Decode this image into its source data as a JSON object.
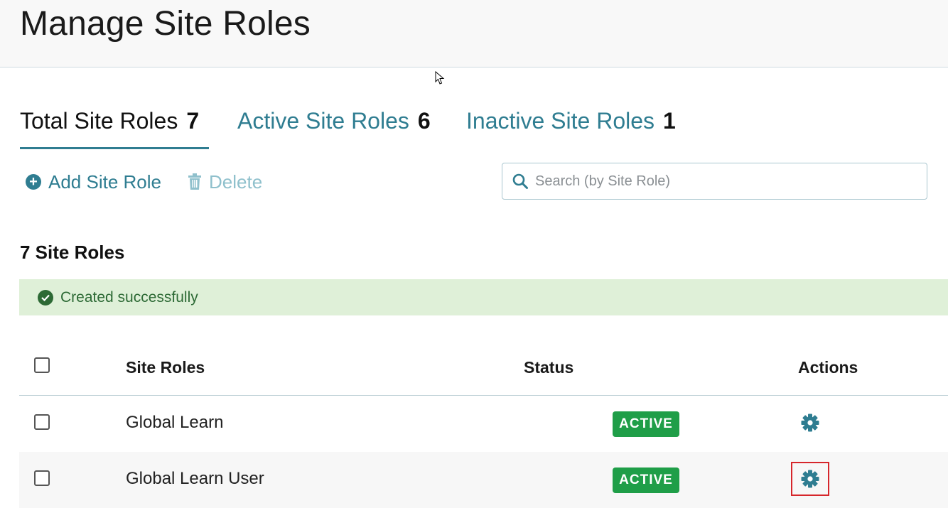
{
  "page": {
    "title": "Manage Site Roles"
  },
  "tabs": [
    {
      "label": "Total Site Roles",
      "count": "7"
    },
    {
      "label": "Active Site Roles",
      "count": "6"
    },
    {
      "label": "Inactive Site Roles",
      "count": "1"
    }
  ],
  "toolbar": {
    "add_label": "Add Site Role",
    "delete_label": "Delete"
  },
  "search": {
    "placeholder": "Search (by Site Role)",
    "value": ""
  },
  "list": {
    "count_heading": "7 Site Roles"
  },
  "alert": {
    "message": "Created successfully"
  },
  "table": {
    "headers": {
      "name": "Site Roles",
      "status": "Status",
      "actions": "Actions"
    },
    "rows": [
      {
        "name": "Global Learn",
        "status": "ACTIVE"
      },
      {
        "name": "Global Learn User",
        "status": "ACTIVE"
      }
    ]
  },
  "colors": {
    "accent": "#2f7d91",
    "active_badge": "#1f9e48",
    "success_bg": "#dff0d8",
    "success_text": "#2d6a35",
    "highlight": "#d6262b"
  },
  "icons": [
    "plus-circle-icon",
    "trash-icon",
    "search-icon",
    "check-circle-icon",
    "gear-icon",
    "cursor-icon"
  ]
}
